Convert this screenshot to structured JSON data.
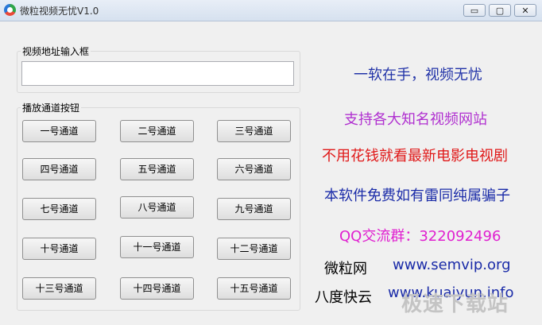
{
  "window": {
    "title": "微粒视频无忧V1.0",
    "controls": {
      "minimize": "▭",
      "maximize": "▢",
      "close": "✕"
    }
  },
  "url_group": {
    "label": "视频地址输入框",
    "input_value": ""
  },
  "channel_group": {
    "label": "播放通道按钮",
    "buttons": [
      "一号通道",
      "二号通道",
      "三号通道",
      "四号通道",
      "五号通道",
      "六号通道",
      "七号通道",
      "八号通道",
      "九号通道",
      "十号通道",
      "十一号通道",
      "十二号通道",
      "十三号通道",
      "十四号通道",
      "十五号通道"
    ]
  },
  "promo": {
    "line1": "一软在手，视频无忧",
    "line2": "支持各大知名视频网站",
    "line3": "不用花钱就看最新电影电视剧",
    "line4": "本软件免费如有雷同纯属骗子",
    "line5": "QQ交流群：322092496",
    "site1_name": "微粒网",
    "site1_url": "www.semvip.org",
    "site2_name": "八度快云",
    "site2_url": "www.kuaiyun.info"
  },
  "colors": {
    "line1": "#2233a8",
    "line2": "#b030d0",
    "line3": "#e01818",
    "line4": "#1a2ba8",
    "line5": "#e020d0",
    "url": "#1a2ba8"
  },
  "watermark": "极速下载站"
}
